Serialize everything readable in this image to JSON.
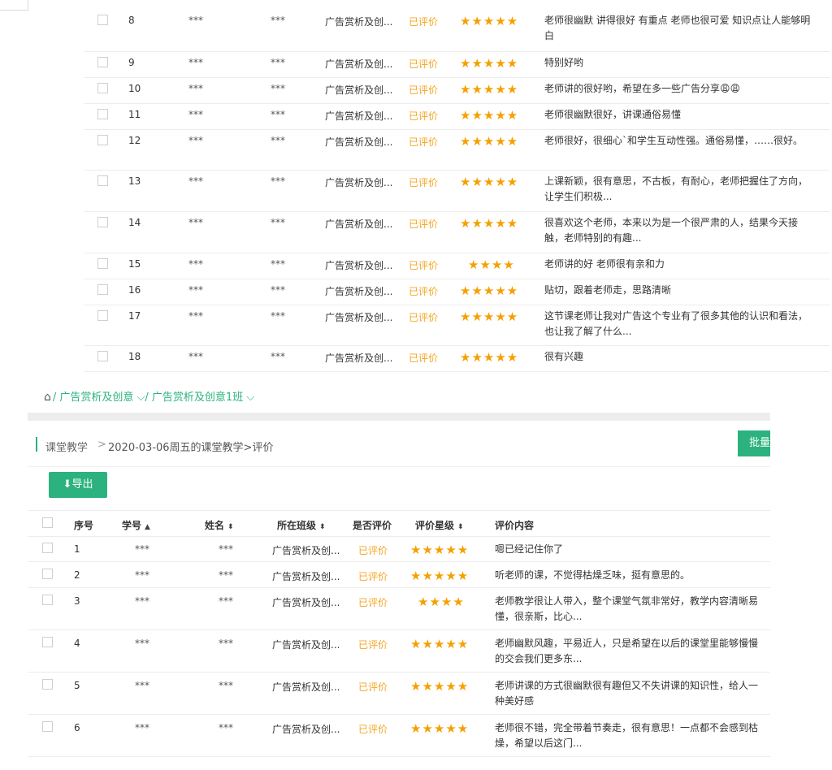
{
  "top_table": {
    "rows": [
      {
        "no": "8",
        "id": "***",
        "name": "***",
        "class": "广告赏析及创...",
        "status": "已评价",
        "stars": "★★★★★",
        "content": "老师很幽默 讲得很好 有重点 老师也很可爱 知识点让人能够明白"
      },
      {
        "no": "9",
        "id": "***",
        "name": "***",
        "class": "广告赏析及创...",
        "status": "已评价",
        "stars": "★★★★★",
        "content": "特别好哟"
      },
      {
        "no": "10",
        "id": "***",
        "name": "***",
        "class": "广告赏析及创...",
        "status": "已评价",
        "stars": "★★★★★",
        "content": "老师讲的很好哟，希望在多一些广告分享😩😩"
      },
      {
        "no": "11",
        "id": "***",
        "name": "***",
        "class": "广告赏析及创...",
        "status": "已评价",
        "stars": "★★★★★",
        "content": "老师很幽默很好，讲课通俗易懂"
      },
      {
        "no": "12",
        "id": "***",
        "name": "***",
        "class": "广告赏析及创...",
        "status": "已评价",
        "stars": "★★★★★",
        "content": "老师很好，很细心`和学生互动性强。通俗易懂，……很好。"
      },
      {
        "no": "13",
        "id": "***",
        "name": "***",
        "class": "广告赏析及创...",
        "status": "已评价",
        "stars": "★★★★★",
        "content": "上课新颖，很有意思，不古板，有耐心，老师把握住了方向，让学生们积极..."
      },
      {
        "no": "14",
        "id": "***",
        "name": "***",
        "class": "广告赏析及创...",
        "status": "已评价",
        "stars": "★★★★★",
        "content": "很喜欢这个老师，本来以为是一个很严肃的人，结果今天接触，老师特别的有趣..."
      },
      {
        "no": "15",
        "id": "***",
        "name": "***",
        "class": "广告赏析及创...",
        "status": "已评价",
        "stars": "★★★★",
        "content": "老师讲的好 老师很有亲和力"
      },
      {
        "no": "16",
        "id": "***",
        "name": "***",
        "class": "广告赏析及创...",
        "status": "已评价",
        "stars": "★★★★★",
        "content": "贴切，跟着老师走，思路清晰"
      },
      {
        "no": "17",
        "id": "***",
        "name": "***",
        "class": "广告赏析及创...",
        "status": "已评价",
        "stars": "★★★★★",
        "content": "这节课老师让我对广告这个专业有了很多其他的认识和看法，也让我了解了什么..."
      },
      {
        "no": "18",
        "id": "***",
        "name": "***",
        "class": "广告赏析及创...",
        "status": "已评价",
        "stars": "★★★★★",
        "content": "很有兴趣"
      }
    ]
  },
  "breadcrumb": {
    "home_icon": "home-icon",
    "level1": "/ 广告赏析及创意",
    "level2": "/ 广告赏析及创意1班",
    "chevron": "⌵"
  },
  "section": {
    "title": "课堂教学",
    "separator": ">",
    "subtitle": "2020-03-06周五的课堂教学>评价",
    "batch_label": "批量",
    "export_label": "⬇导出"
  },
  "bottom_table": {
    "headers": {
      "no": "序号",
      "id": "学号",
      "name": "姓名",
      "class": "所在班级",
      "status": "是否评价",
      "stars": "评价星级",
      "content": "评价内容"
    },
    "sort_up": "▲",
    "sort_both": "⬍",
    "rows": [
      {
        "no": "1",
        "id": "***",
        "name": "***",
        "class": "广告赏析及创...",
        "status": "已评价",
        "stars": "★★★★★",
        "content": "嗯已经记住你了"
      },
      {
        "no": "2",
        "id": "***",
        "name": "***",
        "class": "广告赏析及创...",
        "status": "已评价",
        "stars": "★★★★★",
        "content": "听老师的课，不觉得枯燥乏味，挺有意思的。"
      },
      {
        "no": "3",
        "id": "***",
        "name": "***",
        "class": "广告赏析及创...",
        "status": "已评价",
        "stars": "★★★★",
        "content": "老师教学很让人带入，整个课堂气氛非常好，教学内容清晰易懂，很亲斯，比心..."
      },
      {
        "no": "4",
        "id": "***",
        "name": "***",
        "class": "广告赏析及创...",
        "status": "已评价",
        "stars": "★★★★★",
        "content": "老师幽默风趣，平易近人，只是希望在以后的课堂里能够慢慢的交会我们更多东..."
      },
      {
        "no": "5",
        "id": "***",
        "name": "***",
        "class": "广告赏析及创...",
        "status": "已评价",
        "stars": "★★★★★",
        "content": "老师讲课的方式很幽默很有趣但又不失讲课的知识性，给人一种美好感"
      },
      {
        "no": "6",
        "id": "***",
        "name": "***",
        "class": "广告赏析及创...",
        "status": "已评价",
        "stars": "★★★★★",
        "content": "老师很不错，完全带着节奏走，很有意思！一点都不会感到枯燥，希望以后这门..."
      }
    ]
  },
  "colors": {
    "accent": "#2bb27e",
    "rated": "#f5a623",
    "star": "#f5a000"
  }
}
